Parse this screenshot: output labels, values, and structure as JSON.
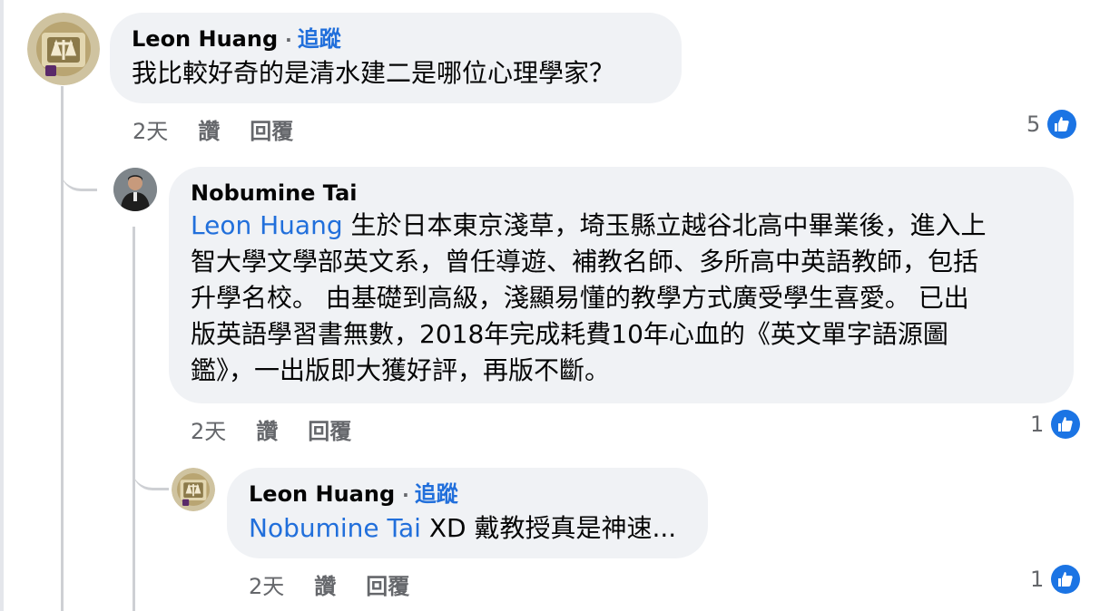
{
  "comments": [
    {
      "author": "Leon Huang",
      "follow": "追蹤",
      "text": "我比較好奇的是清水建二是哪位心理學家？",
      "time": "2天",
      "like_label": "讚",
      "reply_label": "回覆",
      "likes": "5"
    },
    {
      "author": "Nobumine Tai",
      "mention": "Leon Huang",
      "text_lines": [
        " 生於日本東京淺草，埼玉縣立越谷北高中畢業後，進入上",
        "智大學文學部英文系，曾任導遊、補教名師、多所高中英語教師，包括",
        "升學名校。 由基礎到高級，淺顯易懂的教學方式廣受學生喜愛。 已出",
        "版英語學習書無數，2018年完成耗費10年心血的《英文單字語源圖",
        "鑑》，一出版即大獲好評，再版不斷。"
      ],
      "time": "2天",
      "like_label": "讚",
      "reply_label": "回覆",
      "likes": "1"
    },
    {
      "author": "Leon Huang",
      "follow": "追蹤",
      "mention": "Nobumine Tai",
      "text": " XD 戴教授真是神速...",
      "time": "2天",
      "like_label": "讚",
      "reply_label": "回覆",
      "likes": "1"
    }
  ],
  "colors": {
    "bubble": "#f0f2f5",
    "link": "#216fdb",
    "meta": "#65676b",
    "like": "#1b74e4"
  },
  "icons": {
    "like": "thumbs-up-icon",
    "avatar_leon": "golden-emblem-avatar",
    "avatar_nobumine": "portrait-avatar"
  }
}
